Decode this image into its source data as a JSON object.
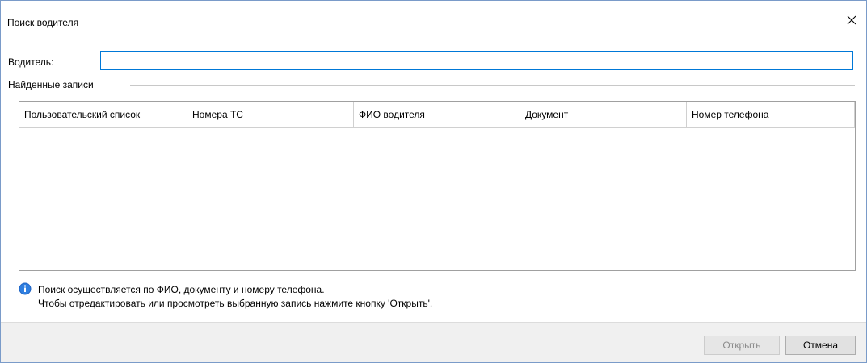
{
  "window": {
    "title": "Поиск водителя",
    "close_icon": "close-icon"
  },
  "search": {
    "label": "Водитель:",
    "value": ""
  },
  "results": {
    "group_label": "Найденные записи",
    "columns": [
      "Пользовательский список",
      "Номера ТС",
      "ФИО водителя",
      "Документ",
      "Номер телефона"
    ],
    "rows": []
  },
  "info": {
    "icon": "info-icon",
    "line1": "Поиск осуществляется по ФИО, документу и номеру телефона.",
    "line2": "Чтобы отредактировать или просмотреть выбранную запись нажмите кнопку 'Открыть'."
  },
  "buttons": {
    "open_label": "Открыть",
    "open_enabled": false,
    "cancel_label": "Отмена"
  },
  "colors": {
    "accent": "#0078d7",
    "footer_bg": "#f0f0f0",
    "disabled_text": "#8c8c8c"
  }
}
